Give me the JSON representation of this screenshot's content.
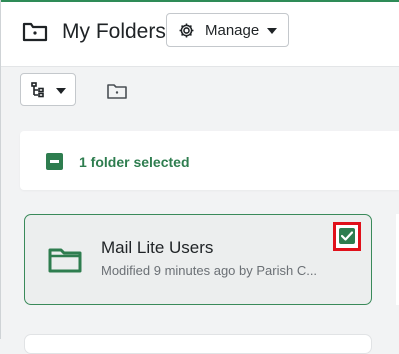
{
  "header": {
    "title": "My Folders",
    "folder_icon": "folder-icon",
    "manage_button": {
      "label": "Manage",
      "icon": "gear-icon"
    }
  },
  "toolbar": {
    "view_toggle_icon": "folder-tree-icon",
    "new_folder_icon": "folder-plus-icon"
  },
  "selection": {
    "text": "1 folder selected"
  },
  "folders": [
    {
      "name": "Mail Lite Users",
      "meta": "Modified 9 minutes ago by Parish C...",
      "selected": true
    }
  ],
  "colors": {
    "accent_green": "#2e7d4f",
    "highlight_red": "#e0101a"
  }
}
